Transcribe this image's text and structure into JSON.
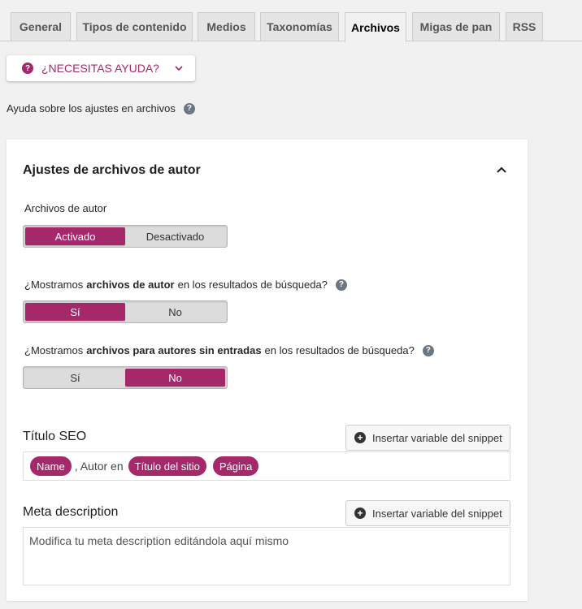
{
  "tabs": [
    "General",
    "Tipos de contenido",
    "Medios",
    "Taxonomías",
    "Archivos",
    "Migas de pan",
    "RSS"
  ],
  "help": {
    "button_label": "¿NECESITAS AYUDA?",
    "help_text": "Ayuda sobre los ajustes en archivos",
    "q": "?"
  },
  "panel": {
    "title": "Ajustes de archivos de autor",
    "author_archives": {
      "label": "Archivos de autor",
      "on": "Activado",
      "off": "Desactivado"
    },
    "q1": {
      "pre": "¿Mostramos",
      "bold": "archivos de autor",
      "post": "en los resultados de búsqueda?",
      "yes": "Sí",
      "no": "No"
    },
    "q2": {
      "pre": "¿Mostramos",
      "bold": "archivos para autores sin entradas",
      "post": "en los resultados de búsqueda?",
      "yes": "Sí",
      "no": "No"
    },
    "seo_title": {
      "label": "Título SEO",
      "insert_label": "Insertar variable del snippet",
      "pill1": "Name",
      "sep": ", Autor en",
      "pill2": "Título del sitio",
      "pill3": "Página"
    },
    "meta": {
      "label": "Meta description",
      "insert_label": "Insertar variable del snippet",
      "placeholder": "Modifica tu meta description editándola aquí mismo"
    }
  },
  "colors": {
    "accent": "#a4286a",
    "toggle_bg": "#dcdcdc"
  }
}
